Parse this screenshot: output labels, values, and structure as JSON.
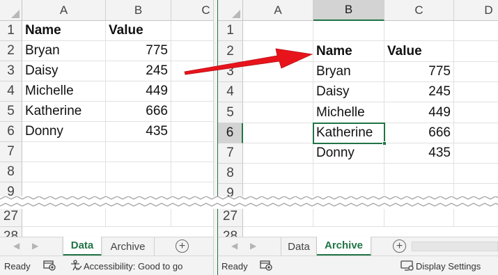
{
  "left_pane": {
    "columns": [
      "A",
      "B",
      "C"
    ],
    "rows_top": [
      "1",
      "2",
      "3",
      "4",
      "5",
      "6",
      "7",
      "8",
      "9"
    ],
    "rows_bottom": [
      "27",
      "28"
    ],
    "table": [
      [
        "Name",
        "Value"
      ],
      [
        "Bryan",
        "775"
      ],
      [
        "Daisy",
        "245"
      ],
      [
        "Michelle",
        "449"
      ],
      [
        "Katherine",
        "666"
      ],
      [
        "Donny",
        "435"
      ]
    ],
    "tabs": [
      "Data",
      "Archive"
    ],
    "active_tab": "Data",
    "status": {
      "ready": "Ready",
      "accessibility": "Accessibility: Good to go"
    }
  },
  "right_pane": {
    "columns": [
      "A",
      "B",
      "C",
      "D"
    ],
    "selected_column": "B",
    "rows_top": [
      "1",
      "2",
      "3",
      "4",
      "5",
      "6",
      "7",
      "8",
      "9"
    ],
    "rows_bottom": [
      "27",
      "28"
    ],
    "selected_row": "6",
    "table": [
      [
        "Name",
        "Value"
      ],
      [
        "Bryan",
        "775"
      ],
      [
        "Daisy",
        "245"
      ],
      [
        "Michelle",
        "449"
      ],
      [
        "Katherine",
        "666"
      ],
      [
        "Donny",
        "435"
      ]
    ],
    "tabs": [
      "Data",
      "Archive"
    ],
    "active_tab": "Archive",
    "status": {
      "ready": "Ready",
      "display_settings": "Display Settings"
    }
  },
  "colors": {
    "excel_green": "#217346",
    "arrow_red": "#e8141c",
    "header_gray": "#f3f3f3"
  },
  "icons": [
    "tear-mark",
    "red-arrow-annotation",
    "macro-record-icon",
    "accessibility-icon",
    "display-settings-icon",
    "add-sheet-icon"
  ]
}
